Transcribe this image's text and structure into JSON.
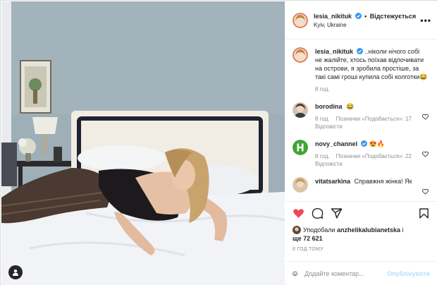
{
  "post": {
    "author": "lesia_nikituk",
    "follow_status": "Відстежується",
    "location": "Kyiv, Ukraine",
    "menu_glyph": "•••",
    "caption": "..ніколи нічого собі не жалійте, хтось поїхав відпочивати на острови, я зробила простіше, за такі самі гроші купила собі колготки😂",
    "caption_time": "8 год."
  },
  "comments": [
    {
      "user": "borodina",
      "text": "😂",
      "time": "8 год.",
      "likes": "Позначки «Подобається»: 17",
      "reply": "Відповісти",
      "avatar_icon": "avatar-borodina"
    },
    {
      "user": "novy_channel",
      "text": "😍🔥",
      "time": "8 год.",
      "likes": "Позначки «Подобається»: 22",
      "reply": "Відповісти",
      "avatar_icon": "avatar-novy-channel",
      "avatar_letter": "H"
    },
    {
      "user": "vitatsarkina",
      "text": "Справжня жінка! Як",
      "avatar_icon": "avatar-vitatsarkina"
    }
  ],
  "actions": {
    "like_icon": "heart-filled-icon",
    "comment_icon": "comment-icon",
    "share_icon": "share-icon",
    "save_icon": "bookmark-icon"
  },
  "likes": {
    "prefix": "Уподобали",
    "user": "anzhelikalubianetska",
    "suffix": "і",
    "count_line": "ще 72 621"
  },
  "post_time": "8 ГОД ТОМУ",
  "comment_box": {
    "placeholder": "Додайте коментар...",
    "publish_label": "Опублікувати",
    "emoji_icon": "emoji-icon"
  },
  "colors": {
    "like_red": "#ed4956",
    "verified_blue": "#3897f0",
    "publish_disabled": "#b2dffc",
    "secondary_text": "#8e8e8e"
  }
}
